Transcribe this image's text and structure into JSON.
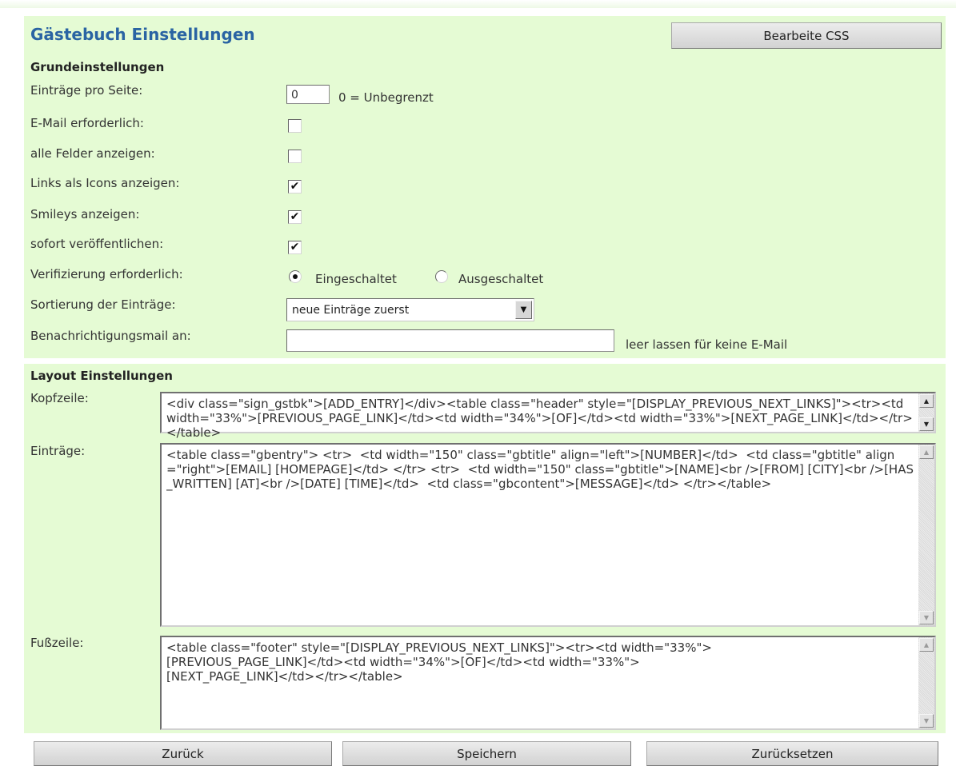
{
  "header": {
    "title": "Gästebuch Einstellungen",
    "css_button": "Bearbeite CSS"
  },
  "basic": {
    "section_title": "Grundeinstellungen",
    "entries_per_page": {
      "label": "Einträge pro Seite:",
      "value": "0",
      "hint": "0 = Unbegrenzt"
    },
    "email_required": {
      "label": "E-Mail erforderlich:",
      "checked": false
    },
    "show_all_fields": {
      "label": "alle Felder anzeigen:",
      "checked": false
    },
    "links_as_icons": {
      "label": "Links als Icons anzeigen:",
      "checked": true
    },
    "show_smileys": {
      "label": "Smileys anzeigen:",
      "checked": true
    },
    "publish_immediately": {
      "label": "sofort veröffentlichen:",
      "checked": true
    },
    "verification": {
      "label": "Verifizierung erforderlich:",
      "option_on": "Eingeschaltet",
      "option_off": "Ausgeschaltet",
      "selected": "Eingeschaltet"
    },
    "sort_order": {
      "label": "Sortierung der Einträge:",
      "selected": "neue Einträge zuerst"
    },
    "notify_mail": {
      "label": "Benachrichtigungsmail an:",
      "value": "",
      "hint": "leer lassen für keine E-Mail"
    }
  },
  "layout": {
    "section_title": "Layout Einstellungen",
    "header_field": {
      "label": "Kopfzeile:",
      "value": "<div class=\"sign_gstbk\">[ADD_ENTRY]</div><table class=\"header\" style=\"[DISPLAY_PREVIOUS_NEXT_LINKS]\"><tr><td width=\"33%\">[PREVIOUS_PAGE_LINK]</td><td width=\"34%\">[OF]</td><td width=\"33%\">[NEXT_PAGE_LINK]</td></tr></table>"
    },
    "entries_field": {
      "label": "Einträge:",
      "value": "<table class=\"gbentry\"> <tr>  <td width=\"150\" class=\"gbtitle\" align=\"left\">[NUMBER]</td>  <td class=\"gbtitle\" align=\"right\">[EMAIL] [HOMEPAGE]</td> </tr> <tr>  <td width=\"150\" class=\"gbtitle\">[NAME]<br />[FROM] [CITY]<br />[HAS_WRITTEN] [AT]<br />[DATE] [TIME]</td>  <td class=\"gbcontent\">[MESSAGE]</td> </tr></table>"
    },
    "footer_field": {
      "label": "Fußzeile:",
      "value": "<table class=\"footer\" style=\"[DISPLAY_PREVIOUS_NEXT_LINKS]\"><tr><td width=\"33%\">\n[PREVIOUS_PAGE_LINK]</td><td width=\"34%\">[OF]</td><td width=\"33%\">\n[NEXT_PAGE_LINK]</td></tr></table>"
    }
  },
  "footer_buttons": {
    "back": "Zurück",
    "save": "Speichern",
    "reset": "Zurücksetzen"
  },
  "colors": {
    "panel_background": "#e5fbd4",
    "title": "#2a64a3"
  }
}
